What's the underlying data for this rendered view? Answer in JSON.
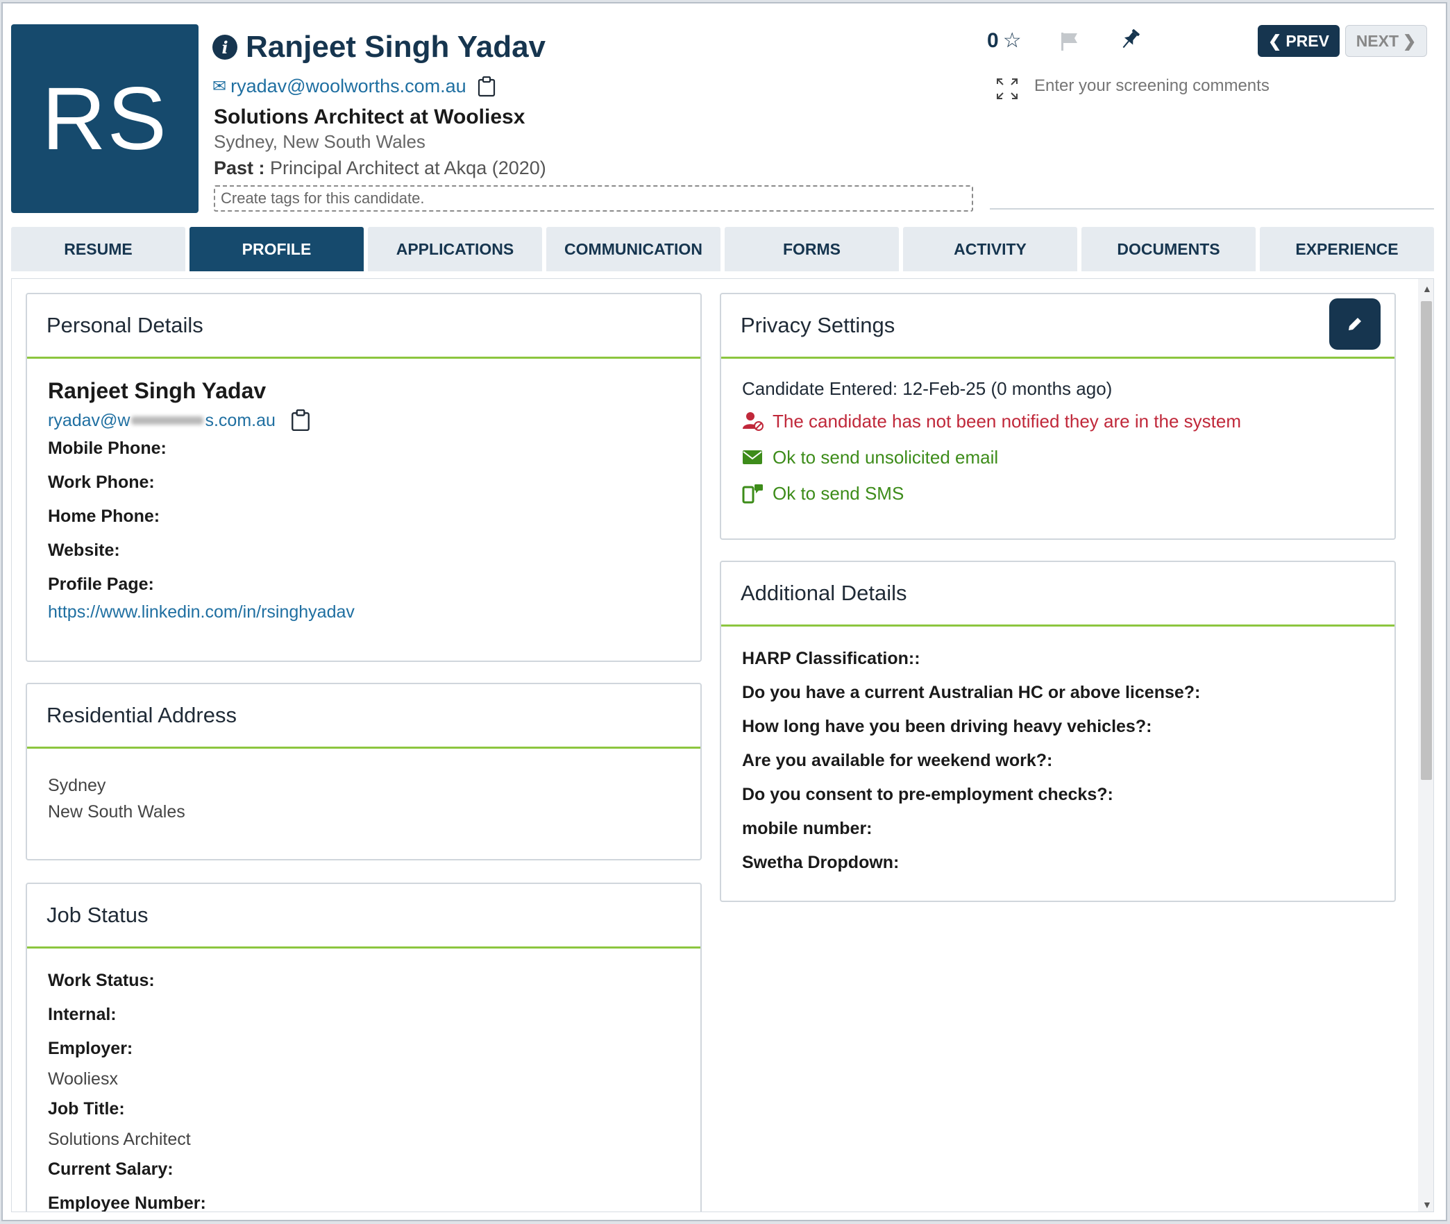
{
  "header": {
    "avatar_initials": "RS",
    "name": "Ranjeet Singh Yadav",
    "email": "ryadav@woolworths.com.au",
    "headline": "Solutions Architect at Wooliesx",
    "location": "Sydney, New South Wales",
    "past_label": "Past :",
    "past_value": "Principal Architect at Akqa (2020)",
    "tags_placeholder": "Create tags for this candidate.",
    "rating": "0",
    "prev_label": "PREV",
    "next_label": "NEXT",
    "screening_placeholder": "Enter your screening comments"
  },
  "tabs": [
    {
      "label": "RESUME"
    },
    {
      "label": "PROFILE"
    },
    {
      "label": "APPLICATIONS"
    },
    {
      "label": "COMMUNICATION"
    },
    {
      "label": "FORMS"
    },
    {
      "label": "ACTIVITY"
    },
    {
      "label": "DOCUMENTS"
    },
    {
      "label": "EXPERIENCE"
    }
  ],
  "personal": {
    "title": "Personal Details",
    "name": "Ranjeet Singh Yadav",
    "email_start": "ryadav@w",
    "email_end": "s.com.au",
    "mobile_label": "Mobile Phone:",
    "work_label": "Work Phone:",
    "home_label": "Home Phone:",
    "website_label": "Website:",
    "profile_label": "Profile Page:",
    "profile_url": "https://www.linkedin.com/in/rsinghyadav"
  },
  "address": {
    "title": "Residential Address",
    "city": "Sydney",
    "state": "New South Wales"
  },
  "job": {
    "title": "Job Status",
    "work_status_label": "Work Status:",
    "internal_label": "Internal:",
    "employer_label": "Employer:",
    "employer_value": "Wooliesx",
    "job_title_label": "Job Title:",
    "job_title_value": "Solutions Architect",
    "salary_label": "Current Salary:",
    "employee_number_label": "Employee Number:"
  },
  "privacy": {
    "title": "Privacy Settings",
    "entered": "Candidate Entered: 12-Feb-25 (0 months ago)",
    "not_notified": "The candidate has not been notified they are in the system",
    "ok_email": "Ok to send unsolicited email",
    "ok_sms": "Ok to send SMS"
  },
  "additional": {
    "title": "Additional Details",
    "fields": [
      "HARP Classification::",
      "Do you have a current Australian HC or above license?:",
      "How long have you been driving heavy vehicles?:",
      "Are you available for weekend work?:",
      "Do you consent to pre-employment checks?:",
      "mobile number:",
      "Swetha Dropdown:"
    ]
  },
  "colors": {
    "brand": "#164a6d",
    "accent_green": "#8cc63f",
    "warning_red": "#c0283a",
    "ok_green": "#3d8c1a"
  }
}
